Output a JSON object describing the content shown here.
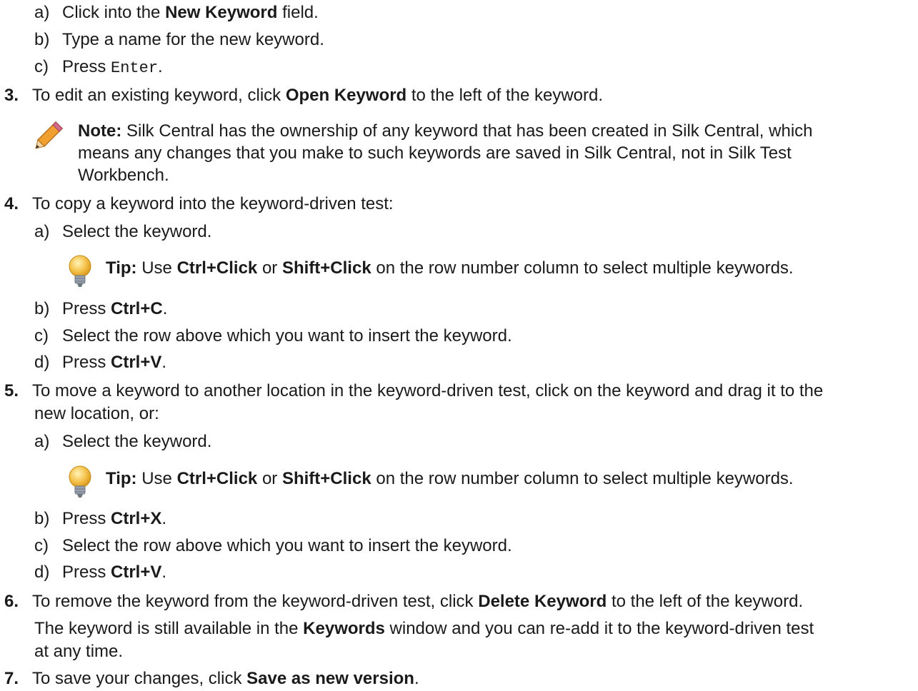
{
  "steps": {
    "sub_a1": {
      "label": "a)",
      "t1": "Click into the ",
      "b1": "New Keyword",
      "t2": " field."
    },
    "sub_b1": {
      "label": "b)",
      "t1": "Type a name for the new keyword."
    },
    "sub_c1": {
      "label": "c)",
      "t1": "Press ",
      "code": "Enter",
      "t2": "."
    },
    "s3": {
      "num": "3.",
      "t1": "To edit an existing keyword, click ",
      "b1": "Open Keyword",
      "t2": " to the left of the keyword."
    },
    "note": {
      "label": "Note:",
      "l1": " Silk Central has the ownership of any keyword that has been created in Silk Central, which",
      "l2": "means any changes that you make to such keywords are saved in Silk Central, not in Silk Test",
      "l3": "Workbench."
    },
    "s4": {
      "num": "4.",
      "t1": "To copy a keyword into the keyword-driven test:"
    },
    "s4a": {
      "label": "a)",
      "t1": "Select the keyword."
    },
    "tip1": {
      "label": "Tip:",
      "t1": " Use ",
      "b1": "Ctrl+Click",
      "t2": " or ",
      "b2": "Shift+Click",
      "t3": " on the row number column to select multiple keywords."
    },
    "s4b": {
      "label": "b)",
      "t1": "Press ",
      "b1": "Ctrl+C",
      "t2": "."
    },
    "s4c": {
      "label": "c)",
      "t1": "Select the row above which you want to insert the keyword."
    },
    "s4d": {
      "label": "d)",
      "t1": "Press ",
      "b1": "Ctrl+V",
      "t2": "."
    },
    "s5": {
      "num": "5.",
      "l1": "To move a keyword to another location in the keyword-driven test, click on the keyword and drag it to the",
      "l2": "new location, or:"
    },
    "s5a": {
      "label": "a)",
      "t1": "Select the keyword."
    },
    "tip2": {
      "label": "Tip:",
      "t1": " Use ",
      "b1": "Ctrl+Click",
      "t2": " or ",
      "b2": "Shift+Click",
      "t3": " on the row number column to select multiple keywords."
    },
    "s5b": {
      "label": "b)",
      "t1": "Press ",
      "b1": "Ctrl+X",
      "t2": "."
    },
    "s5c": {
      "label": "c)",
      "t1": "Select the row above which you want to insert the keyword."
    },
    "s5d": {
      "label": "d)",
      "t1": "Press ",
      "b1": "Ctrl+V",
      "t2": "."
    },
    "s6": {
      "num": "6.",
      "t1": "To remove the keyword from the keyword-driven test, click ",
      "b1": "Delete Keyword",
      "t2": " to the left of the keyword.",
      "c1": "The keyword is still available in the ",
      "cb1": "Keywords",
      "c2": " window and you can re-add it to the keyword-driven test",
      "c3": "at any time."
    },
    "s7": {
      "num": "7.",
      "t1": "To save your changes, click ",
      "b1": "Save as new version",
      "t2": "."
    }
  },
  "icons": {
    "note": "pencil-icon",
    "tip": "lightbulb-icon"
  },
  "colors": {
    "pencil_body": "#f0a030",
    "bulb": "#f5c24a",
    "text": "#1a1a1a"
  }
}
